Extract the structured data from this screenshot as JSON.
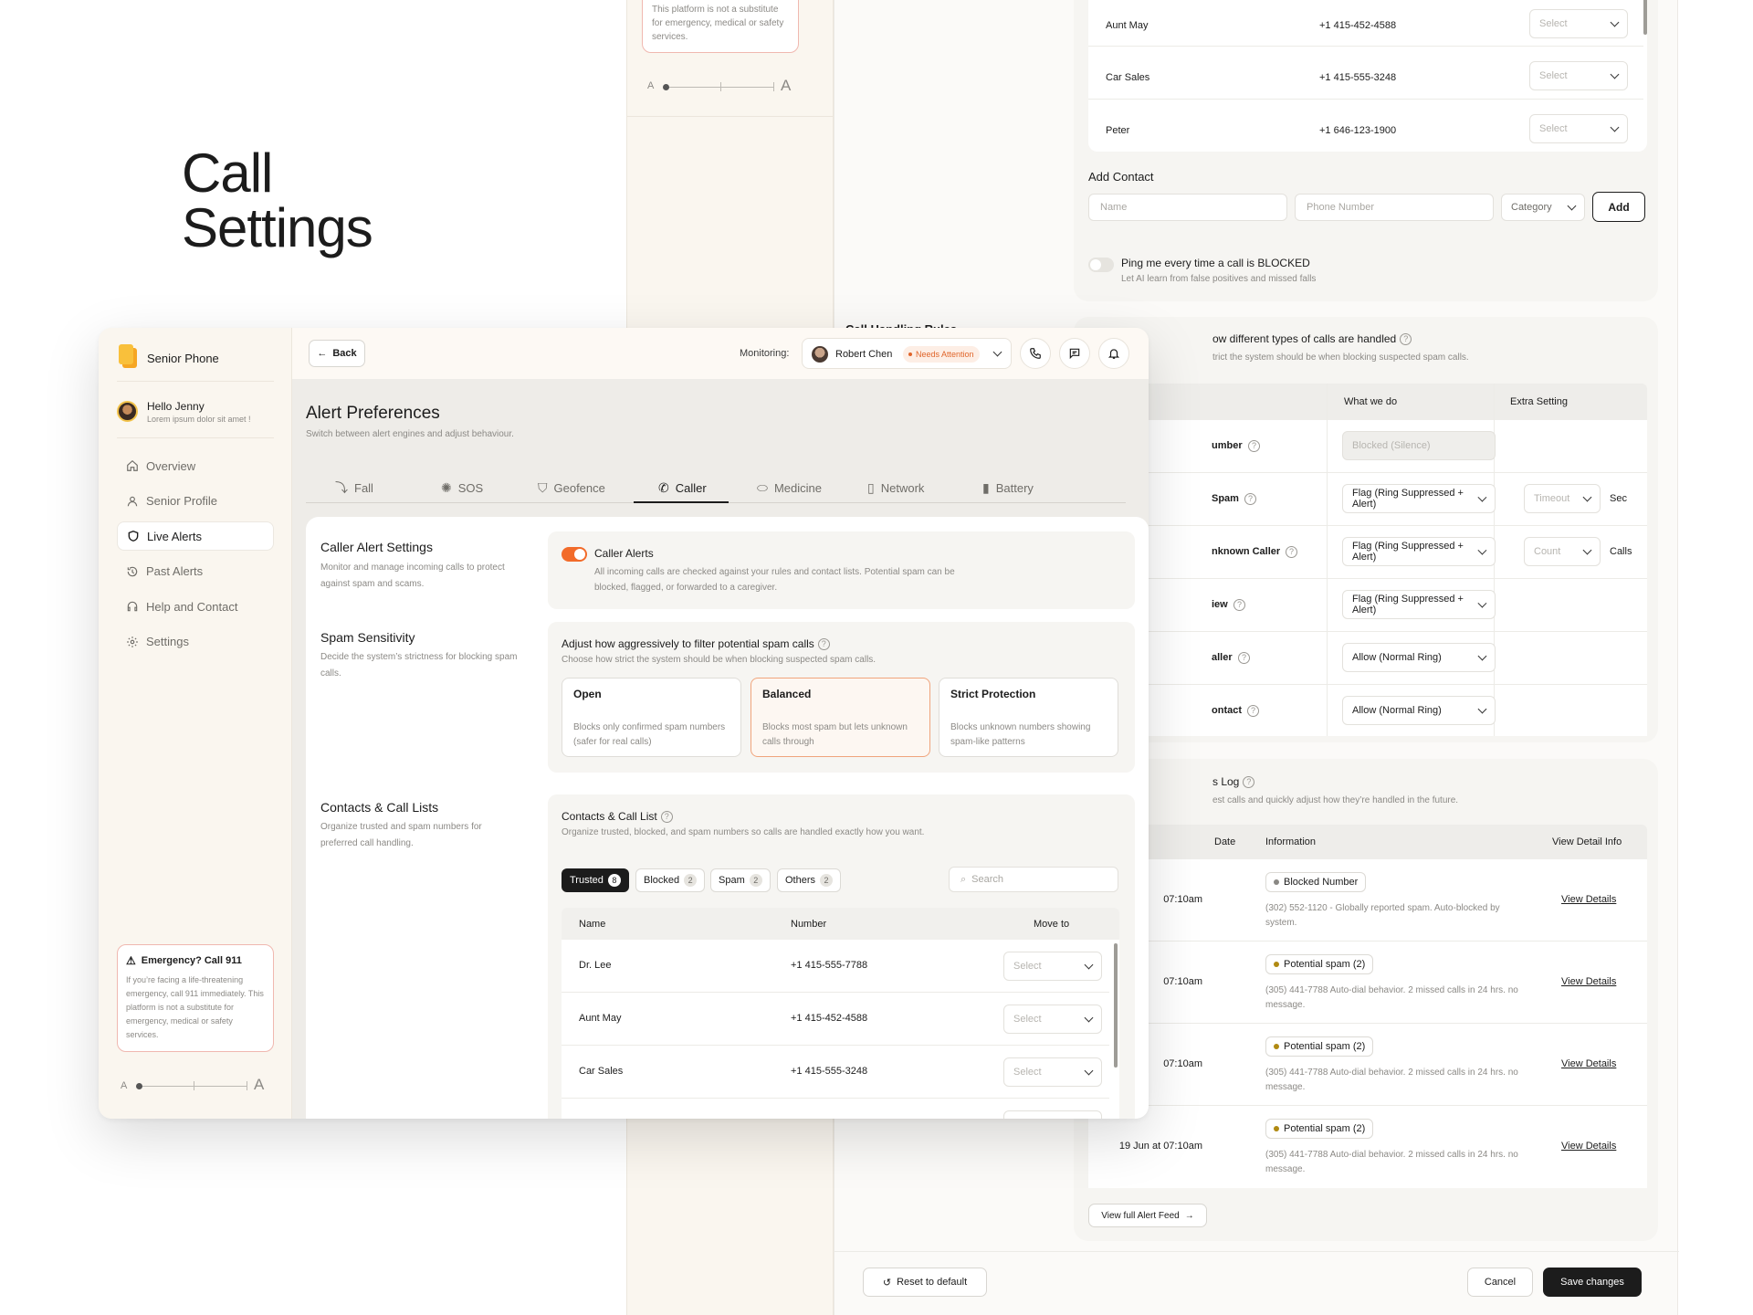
{
  "hero": {
    "title_line1": "Call",
    "title_line2": "Settings"
  },
  "back_left": {
    "emergency_text": "This platform is not a substitute for emergency, medical or safety services.",
    "font_small": "A",
    "font_large": "A"
  },
  "back_right": {
    "contacts": [
      {
        "name": "Aunt May",
        "number": "+1 415-452-4588",
        "move": "Select"
      },
      {
        "name": "Car Sales",
        "number": "+1 415-555-3248",
        "move": "Select"
      },
      {
        "name": "Peter",
        "number": "+1 646-123-1900",
        "move": "Select"
      }
    ],
    "add_contact": {
      "title": "Add Contact",
      "name_placeholder": "Name",
      "phone_placeholder": "Phone Number",
      "category": "Category",
      "add_label": "Add"
    },
    "ping": {
      "label": "Ping me every time a call is BLOCKED",
      "sub": "Let AI learn from false positives and missed falls"
    },
    "rules": {
      "peek_title": "Call Handling Rules",
      "title": "ow different types of calls are handled",
      "sub": "trict the system should be when blocking suspected spam calls.",
      "col_do": "What we do",
      "col_extra": "Extra Setting",
      "rows": [
        {
          "label": "umber",
          "action": "Blocked (Silence)",
          "disabled": true,
          "extra": "",
          "extra_unit": ""
        },
        {
          "label": "Spam",
          "action": "Flag (Ring Suppressed + Alert)",
          "disabled": false,
          "extra": "Timeout",
          "extra_unit": "Sec"
        },
        {
          "label": "nknown Caller",
          "action": "Flag (Ring Suppressed + Alert)",
          "disabled": false,
          "extra": "Count",
          "extra_unit": "Calls"
        },
        {
          "label": "iew",
          "action": "Flag (Ring Suppressed + Alert)",
          "disabled": false,
          "extra": "",
          "extra_unit": ""
        },
        {
          "label": "aller",
          "action": "Allow (Normal Ring)",
          "disabled": false,
          "extra": "",
          "extra_unit": ""
        },
        {
          "label": "ontact",
          "action": "Allow (Normal Ring)",
          "disabled": false,
          "extra": "",
          "extra_unit": ""
        }
      ]
    },
    "log": {
      "title": "s Log",
      "sub": "est calls and quickly adjust how they’re handled in the future.",
      "col_date": "Date",
      "col_info": "Information",
      "col_view": "View Detail Info",
      "rows": [
        {
          "date": "07:10am",
          "badge": "Blocked Number",
          "badge_color": "#8a8884",
          "detail": "(302) 552-1120 - Globally reported spam. Auto-blocked by system.",
          "link": "View Details"
        },
        {
          "date": "07:10am",
          "badge": "Potential spam (2)",
          "badge_color": "#b08a12",
          "detail": "(305) 441-7788  Auto-dial behavior. 2 missed calls in 24 hrs. no message.",
          "link": "View Details"
        },
        {
          "date": "07:10am",
          "badge": "Potential spam (2)",
          "badge_color": "#b08a12",
          "detail": "(305) 441-7788  Auto-dial behavior. 2 missed calls in 24 hrs. no message.",
          "link": "View Details"
        },
        {
          "date": "19 Jun at 07:10am",
          "badge": "Potential spam (2)",
          "badge_color": "#b08a12",
          "detail": "(305) 441-7788  Auto-dial behavior. 2 missed calls in 24 hrs. no message.",
          "link": "View Details"
        }
      ],
      "feed_button": "View full Alert Feed"
    },
    "footer": {
      "reset": "Reset to default",
      "cancel": "Cancel",
      "save": "Save changes"
    }
  },
  "app": {
    "brand": "Senior Phone",
    "user": {
      "greeting": "Hello Jenny",
      "sub": "Lorem ipsum dolor sit amet !"
    },
    "nav": [
      {
        "label": "Overview",
        "icon": "home-icon"
      },
      {
        "label": "Senior Profile",
        "icon": "user-icon"
      },
      {
        "label": "Live Alerts",
        "icon": "shield-icon",
        "active": true
      },
      {
        "label": "Past Alerts",
        "icon": "history-icon"
      },
      {
        "label": "Help and Contact",
        "icon": "headset-icon"
      },
      {
        "label": "Settings",
        "icon": "gear-icon"
      }
    ],
    "emergency": {
      "title": "Emergency? Call 911",
      "text": "If you’re facing a life-threatening emergency, call 911 immediately. This platform is not a substitute for emergency, medical or safety services."
    },
    "font_small": "A",
    "font_large": "A",
    "topbar": {
      "back": "Back",
      "monitoring_label": "Monitoring:",
      "person": "Robert Chen",
      "status": "Needs Attention"
    },
    "page": {
      "title": "Alert Preferences",
      "sub": "Switch between alert engines and adjust behaviour."
    },
    "tabs": [
      {
        "label": "Fall",
        "icon": "fall-icon"
      },
      {
        "label": "SOS",
        "icon": "siren-icon"
      },
      {
        "label": "Geofence",
        "icon": "geofence-shield-icon"
      },
      {
        "label": "Caller",
        "icon": "phone-off-icon",
        "active": true
      },
      {
        "label": "Medicine",
        "icon": "pill-icon"
      },
      {
        "label": "Network",
        "icon": "device-icon"
      },
      {
        "label": "Battery",
        "icon": "battery-icon"
      }
    ],
    "caller_settings": {
      "title": "Caller Alert Settings",
      "desc": "Monitor and manage incoming calls to protect against spam and scams.",
      "toggle_label": "Caller Alerts",
      "toggle_desc": "All incoming calls are checked against your rules and contact lists. Potential spam can be blocked, flagged, or forwarded to a caregiver."
    },
    "spam": {
      "title": "Spam Sensitivity",
      "desc": "Decide the system’s strictness for blocking spam calls.",
      "q": "Adjust how aggressively to filter potential spam calls",
      "q_sub": "Choose how strict the system should be when blocking suspected spam calls.",
      "options": [
        {
          "title": "Open",
          "desc": "Blocks only confirmed spam numbers (safer for real calls)"
        },
        {
          "title": "Balanced",
          "desc": "Blocks most spam but lets unknown calls through",
          "selected": true
        },
        {
          "title": "Strict Protection",
          "desc": "Blocks unknown numbers showing spam-like patterns"
        }
      ]
    },
    "contacts": {
      "title": "Contacts & Call Lists",
      "desc": "Organize trusted and spam numbers for preferred call handling.",
      "list_title": "Contacts & Call List",
      "list_sub": "Organize trusted, blocked, and spam numbers so calls are handled exactly how you want.",
      "filters": [
        {
          "label": "Trusted",
          "count": "8",
          "active": true
        },
        {
          "label": "Blocked",
          "count": "2"
        },
        {
          "label": "Spam",
          "count": "2"
        },
        {
          "label": "Others",
          "count": "2"
        }
      ],
      "search_placeholder": "Search",
      "col_name": "Name",
      "col_number": "Number",
      "col_move": "Move to",
      "rows": [
        {
          "name": "Dr. Lee",
          "number": "+1 415-555-7788",
          "move": "Select"
        },
        {
          "name": "Aunt May",
          "number": "+1 415-452-4588",
          "move": "Select"
        },
        {
          "name": "Car Sales",
          "number": "+1 415-555-3248",
          "move": "Select"
        }
      ]
    }
  },
  "colors": {
    "accent": "#f26b2a",
    "sidebar_bg": "#faf6ef",
    "dark": "#1c1c1c"
  }
}
